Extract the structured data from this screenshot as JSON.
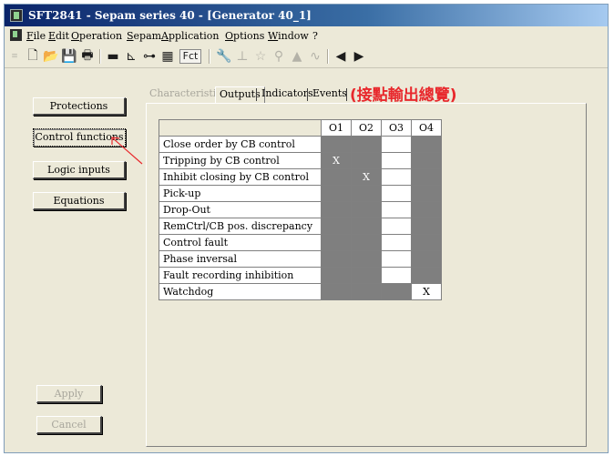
{
  "window": {
    "title": "SFT2841 - Sepam series 40 - [Generator 40_1]"
  },
  "menu": [
    "File",
    "Edit",
    "Operation",
    "Sepam",
    "Application",
    "Options",
    "Window",
    "?"
  ],
  "toolbar": {
    "fct_label": "Fct"
  },
  "sidebar": {
    "protections": "Protections",
    "control_functions": "Control functions",
    "logic_inputs": "Logic inputs",
    "equations": "Equations",
    "apply": "Apply",
    "cancel": "Cancel"
  },
  "tabs": {
    "characteristics": "Characteristics",
    "outputs": "Outputs",
    "indicators": "Indicators",
    "events": "Events"
  },
  "annotation": "(接點輸出總覽)",
  "matrix": {
    "columns": [
      "O1",
      "O2",
      "O3",
      "O4"
    ],
    "rows": [
      {
        "label": "Close order by CB control",
        "cells": [
          "",
          "",
          "",
          ""
        ],
        "states": [
          "on",
          "on",
          "off",
          "on"
        ]
      },
      {
        "label": "Tripping by CB control",
        "cells": [
          "X",
          "",
          "",
          ""
        ],
        "states": [
          "on",
          "on",
          "off",
          "on"
        ]
      },
      {
        "label": "Inhibit closing by CB control",
        "cells": [
          "",
          "X",
          "",
          ""
        ],
        "states": [
          "on",
          "on",
          "off",
          "on"
        ]
      },
      {
        "label": "Pick-up",
        "cells": [
          "",
          "",
          "",
          ""
        ],
        "states": [
          "on",
          "on",
          "off",
          "on"
        ]
      },
      {
        "label": "Drop-Out",
        "cells": [
          "",
          "",
          "",
          ""
        ],
        "states": [
          "on",
          "on",
          "off",
          "on"
        ]
      },
      {
        "label": "RemCtrl/CB pos. discrepancy",
        "cells": [
          "",
          "",
          "",
          ""
        ],
        "states": [
          "on",
          "on",
          "off",
          "on"
        ]
      },
      {
        "label": "Control fault",
        "cells": [
          "",
          "",
          "",
          ""
        ],
        "states": [
          "on",
          "on",
          "off",
          "on"
        ]
      },
      {
        "label": "Phase inversal",
        "cells": [
          "",
          "",
          "",
          ""
        ],
        "states": [
          "on",
          "on",
          "off",
          "on"
        ]
      },
      {
        "label": "Fault recording inhibition",
        "cells": [
          "",
          "",
          "",
          ""
        ],
        "states": [
          "on",
          "on",
          "off",
          "on"
        ]
      },
      {
        "label": "Watchdog",
        "cells": [
          "",
          "",
          "",
          "X"
        ],
        "states": [
          "on",
          "on",
          "on",
          "off"
        ]
      }
    ]
  },
  "colors": {
    "annotation": "#e8282c",
    "assignable_cell": "#7f7f7f"
  }
}
